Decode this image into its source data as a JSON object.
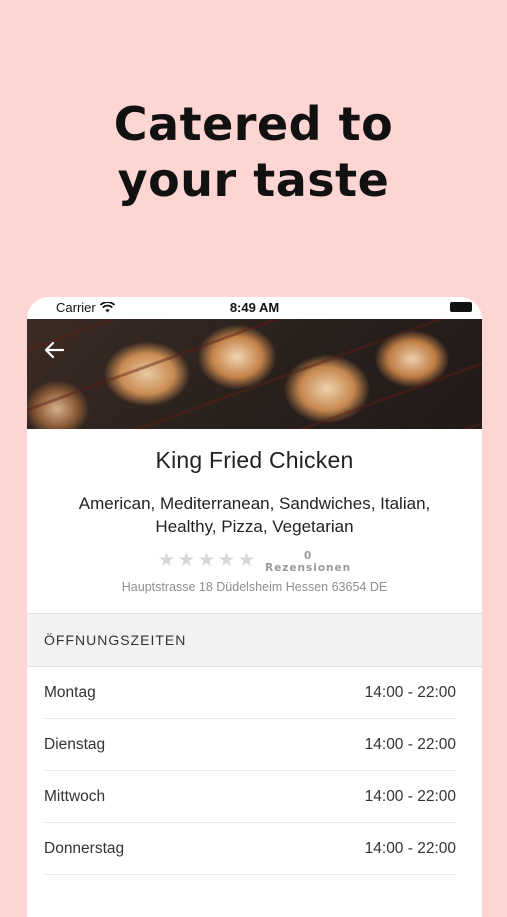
{
  "headline": {
    "line1": "Catered to",
    "line2": "your taste"
  },
  "status_bar": {
    "carrier": "Carrier",
    "time": "8:49 AM"
  },
  "restaurant": {
    "name": "King Fried Chicken",
    "cuisines": "American, Mediterranean, Sandwiches, Italian, Healthy, Pizza, Vegetarian",
    "rating": {
      "stars_filled": 0,
      "stars_total": 5,
      "review_count": "0",
      "review_label": "Rezensionen"
    },
    "address": "Hauptstrasse 18 Düdelsheim Hessen 63654 DE"
  },
  "opening_hours": {
    "title": "ÖFFNUNGSZEITEN",
    "days": [
      {
        "day": "Montag",
        "hours": "14:00 - 22:00"
      },
      {
        "day": "Dienstag",
        "hours": "14:00 - 22:00"
      },
      {
        "day": "Mittwoch",
        "hours": "14:00 - 22:00"
      },
      {
        "day": "Donnerstag",
        "hours": "14:00 - 22:00"
      }
    ]
  },
  "colors": {
    "background": "#fdd5d2",
    "star_empty": "#d6d6d6"
  },
  "icons": [
    "wifi-icon",
    "battery-icon",
    "back-arrow-icon",
    "star-icon"
  ]
}
